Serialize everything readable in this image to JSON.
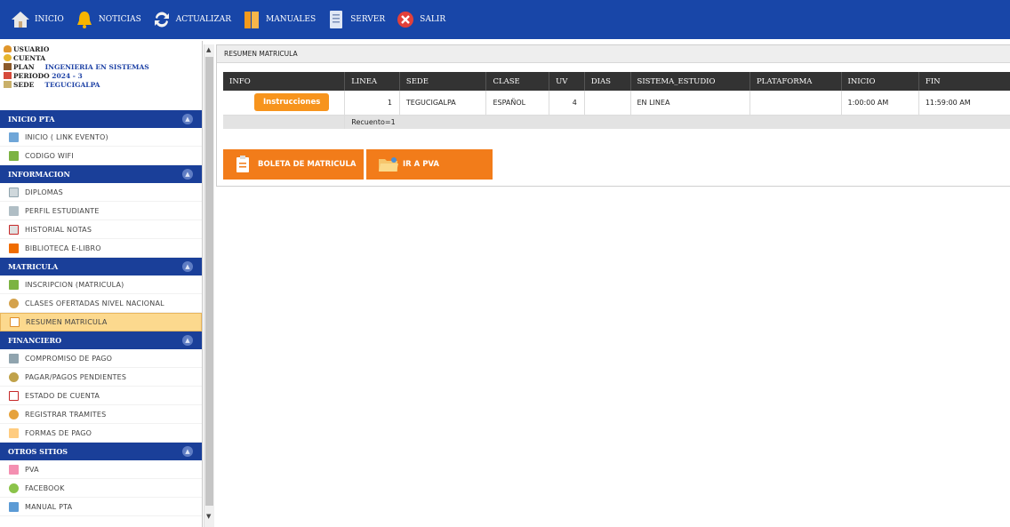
{
  "topbar": {
    "items": [
      {
        "label": "INICIO",
        "icon": "home-icon"
      },
      {
        "label": "NOTICIAS",
        "icon": "bell-icon"
      },
      {
        "label": "ACTUALIZAR",
        "icon": "refresh-icon"
      },
      {
        "label": "MANUALES",
        "icon": "book-icon"
      },
      {
        "label": "SERVER",
        "icon": "server-icon"
      },
      {
        "label": "SALIR",
        "icon": "close-icon"
      }
    ]
  },
  "userinfo": {
    "usuario_label": "USUARIO",
    "cuenta_label": "CUENTA",
    "plan_label": "PLAN",
    "plan_value": "INGENIERIA EN SISTEMAS",
    "periodo_label": "PERIODO",
    "periodo_value": "2024 - 3",
    "sede_label": "SEDE",
    "sede_value": "TEGUCIGALPA"
  },
  "sidebar": {
    "sections": [
      {
        "title": "INICIO PTA",
        "items": [
          {
            "label": "INICIO ( LINK EVENTO)",
            "icon": "home-icon"
          },
          {
            "label": "CODIGO WIFI",
            "icon": "wifi-icon"
          }
        ]
      },
      {
        "title": "INFORMACION",
        "items": [
          {
            "label": "DIPLOMAS",
            "icon": "diploma-icon"
          },
          {
            "label": "PERFIL ESTUDIANTE",
            "icon": "profile-icon"
          },
          {
            "label": "HISTORIAL NOTAS",
            "icon": "notes-icon"
          },
          {
            "label": "BIBLIOTECA E-LIBRO",
            "icon": "library-icon"
          }
        ]
      },
      {
        "title": "MATRICULA",
        "items": [
          {
            "label": "INSCRIPCION (MATRICULA)",
            "icon": "enroll-icon"
          },
          {
            "label": "CLASES OFERTADAS NIVEL NACIONAL",
            "icon": "classes-icon"
          },
          {
            "label": "RESUMEN MATRICULA",
            "icon": "summary-icon",
            "active": true
          }
        ]
      },
      {
        "title": "FINANCIERO",
        "items": [
          {
            "label": "COMPROMISO DE PAGO",
            "icon": "payment-commit-icon"
          },
          {
            "label": "PAGAR/PAGOS PENDIENTES",
            "icon": "coins-icon"
          },
          {
            "label": "ESTADO DE CUENTA",
            "icon": "chart-icon"
          },
          {
            "label": "REGISTRAR TRAMITES",
            "icon": "register-icon"
          },
          {
            "label": "FORMAS DE PAGO",
            "icon": "forms-icon"
          }
        ]
      },
      {
        "title": "OTROS SITIOS",
        "items": [
          {
            "label": "PVA",
            "icon": "pva-icon"
          },
          {
            "label": "FACEBOOK",
            "icon": "facebook-icon"
          },
          {
            "label": "MANUAL PTA",
            "icon": "manual-icon"
          }
        ]
      }
    ]
  },
  "main": {
    "panel_title": "RESUMEN MATRICULA",
    "table": {
      "headers": [
        "INFO",
        "LINEA",
        "SEDE",
        "CLASE",
        "UV",
        "DIAS",
        "SISTEMA_ESTUDIO",
        "PLATAFORMA",
        "INICIO",
        "FIN"
      ],
      "row": {
        "info_button": "Instrucciones",
        "linea": "1",
        "sede": "TEGUCIGALPA",
        "clase": "ESPAÑOL",
        "uv": "4",
        "dias": "",
        "sistema_estudio": "EN LINEA",
        "plataforma": "",
        "inicio": "1:00:00 AM",
        "fin": "11:59:00 AM"
      },
      "count_label": "Recuento=1"
    },
    "buttons": {
      "boleta": "BOLETA DE MATRICULA",
      "pva": "IR A PVA"
    }
  },
  "colors": {
    "topbar": "#1846a8",
    "section_header": "#1a3f99",
    "accent_orange": "#f27c1a",
    "active_item": "#fcd98e"
  }
}
